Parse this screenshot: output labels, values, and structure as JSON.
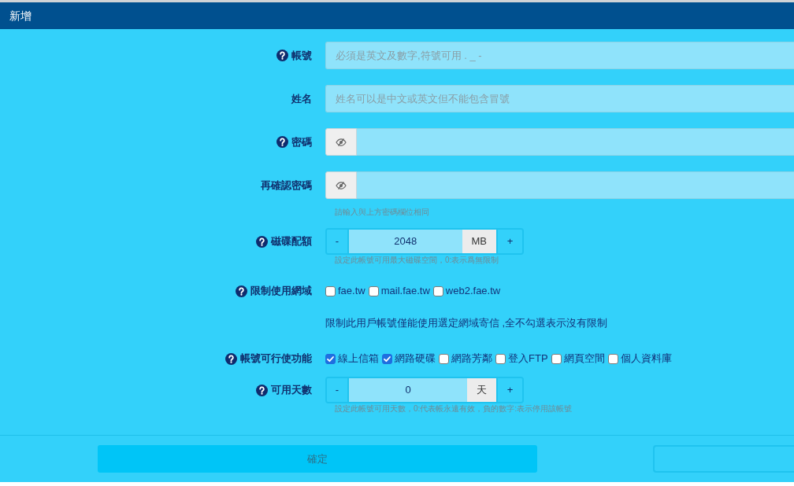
{
  "window": {
    "title": "新增"
  },
  "fields": [
    {
      "kind": "text",
      "label": "帳號",
      "help": true,
      "placeholder": "必須是英文及數字,符號可用 . _ -"
    },
    {
      "kind": "text",
      "label": "姓名",
      "help": false,
      "placeholder": "姓名可以是中文或英文但不能包含冒號"
    },
    {
      "kind": "password",
      "label": "密碼",
      "help": true
    },
    {
      "kind": "password",
      "label": "再確認密碼",
      "help": false,
      "hint": "請輸入與上方密碼欄位相同"
    },
    {
      "kind": "stepper",
      "label": "磁碟配額",
      "help": true,
      "decrement": "-",
      "value": "2048",
      "unit": "MB",
      "increment": "+",
      "hint": "設定此帳號可用最大磁碟空間，0:表示爲無限制"
    },
    {
      "kind": "checkboxes",
      "label": "限制使用網域",
      "help": true,
      "options": [
        {
          "label": "fae.tw",
          "checked": false
        },
        {
          "label": "mail.fae.tw",
          "checked": false
        },
        {
          "label": "web2.fae.tw",
          "checked": false
        }
      ]
    },
    {
      "kind": "note",
      "text": "限制此用戶帳號僅能使用選定網域寄信 ,全不勾選表示沒有限制"
    },
    {
      "kind": "checkboxes",
      "label": "帳號可行使功能",
      "help": true,
      "options": [
        {
          "label": "線上信箱",
          "checked": true
        },
        {
          "label": "網路硬碟",
          "checked": true
        },
        {
          "label": "網路芳鄰",
          "checked": false
        },
        {
          "label": "登入FTP",
          "checked": false
        },
        {
          "label": "網頁空間",
          "checked": false
        },
        {
          "label": "個人資料庫",
          "checked": false
        }
      ]
    },
    {
      "kind": "stepper",
      "label": "可用天數",
      "help": true,
      "decrement": "-",
      "value": "0",
      "unit": "天",
      "increment": "+",
      "hint": "設定此帳號可用天數，0:代表帳永遠有效，負的數字:表示停用該帳號"
    }
  ],
  "buttons": [
    {
      "kind": "primary",
      "label": "確定"
    },
    {
      "kind": "outline"
    }
  ]
}
